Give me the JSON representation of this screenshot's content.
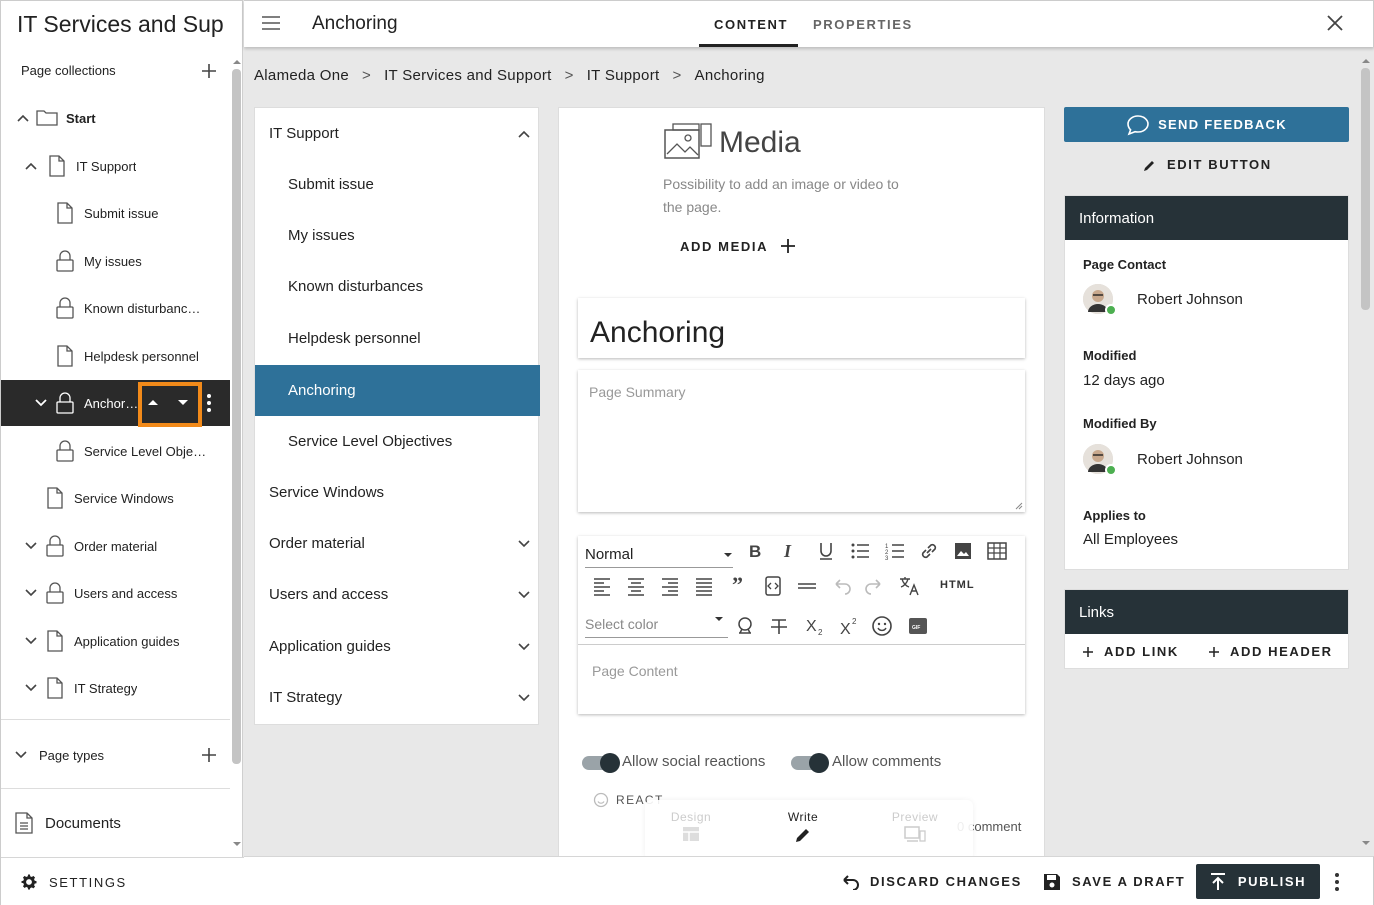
{
  "sidebar": {
    "app_title": "IT Services and Sup",
    "page_collections_label": "Page collections",
    "page_types_label": "Page types",
    "documents_label": "Documents",
    "settings_label": "SETTINGS",
    "tree": [
      {
        "label": "Start",
        "icon": "folder-icon",
        "expanded": true
      },
      {
        "label": "IT Support",
        "icon": "page-icon",
        "expanded": true
      },
      {
        "label": "Submit issue",
        "icon": "page-icon"
      },
      {
        "label": "My issues",
        "icon": "lock-icon"
      },
      {
        "label": "Known disturbanc…",
        "icon": "lock-icon"
      },
      {
        "label": "Helpdesk personnel",
        "icon": "page-icon"
      },
      {
        "label": "Anchori…",
        "icon": "lock-icon",
        "selected": true
      },
      {
        "label": "Service Level Obje…",
        "icon": "lock-icon"
      },
      {
        "label": "Service Windows",
        "icon": "page-icon"
      },
      {
        "label": "Order material",
        "icon": "lock-icon",
        "collapsed": true
      },
      {
        "label": "Users and access",
        "icon": "lock-icon",
        "collapsed": true
      },
      {
        "label": "Application guides",
        "icon": "page-icon",
        "collapsed": true
      },
      {
        "label": "IT Strategy",
        "icon": "page-icon",
        "collapsed": true
      }
    ]
  },
  "topbar": {
    "title": "Anchoring",
    "tab_content": "CONTENT",
    "tab_properties": "PROPERTIES"
  },
  "breadcrumb": [
    "Alameda One",
    "IT Services and Support",
    "IT Support",
    "Anchoring"
  ],
  "breadcrumb_sep": ">",
  "page_nav": [
    {
      "label": "IT Support",
      "level": 0,
      "chevron": "up"
    },
    {
      "label": "Submit issue",
      "level": 1
    },
    {
      "label": "My issues",
      "level": 1
    },
    {
      "label": "Known disturbances",
      "level": 1
    },
    {
      "label": "Helpdesk personnel",
      "level": 1
    },
    {
      "label": "Anchoring",
      "level": 1,
      "selected": true
    },
    {
      "label": "Service Level Objectives",
      "level": 1
    },
    {
      "label": "Service Windows",
      "level": 0
    },
    {
      "label": "Order material",
      "level": 0,
      "chevron": "down"
    },
    {
      "label": "Users and access",
      "level": 0,
      "chevron": "down"
    },
    {
      "label": "Application guides",
      "level": 0,
      "chevron": "down"
    },
    {
      "label": "IT Strategy",
      "level": 0,
      "chevron": "down"
    }
  ],
  "editor": {
    "media_title": "Media",
    "media_desc_line1": "Possibility to add an image or video to",
    "media_desc_line2": "the page.",
    "add_media": "ADD MEDIA",
    "page_title": "Anchoring",
    "summary_placeholder": "Page Summary",
    "style_select": "Normal",
    "color_select": "Select color",
    "html_label": "HTML",
    "content_placeholder": "Page Content",
    "allow_social": "Allow social reactions",
    "allow_comments": "Allow comments",
    "react_label": "REACT",
    "comment_label": "0 comment",
    "mode_design": "Design",
    "mode_write": "Write",
    "mode_preview": "Preview"
  },
  "right": {
    "feedback": "SEND FEEDBACK",
    "edit_button": "EDIT BUTTON",
    "info_title": "Information",
    "page_contact_label": "Page Contact",
    "page_contact": "Robert Johnson",
    "modified_label": "Modified",
    "modified": "12 days ago",
    "modified_by_label": "Modified By",
    "modified_by": "Robert Johnson",
    "applies_label": "Applies to",
    "applies": "All Employees",
    "links_title": "Links",
    "add_link": "ADD LINK",
    "add_header": "ADD HEADER"
  },
  "bottombar": {
    "discard": "DISCARD CHANGES",
    "save_draft": "SAVE A DRAFT",
    "publish": "PUBLISH"
  },
  "colors": {
    "accent": "#2e7199",
    "dark": "#263238",
    "highlight_box": "#f28a1a",
    "status_online": "#4caf50"
  }
}
